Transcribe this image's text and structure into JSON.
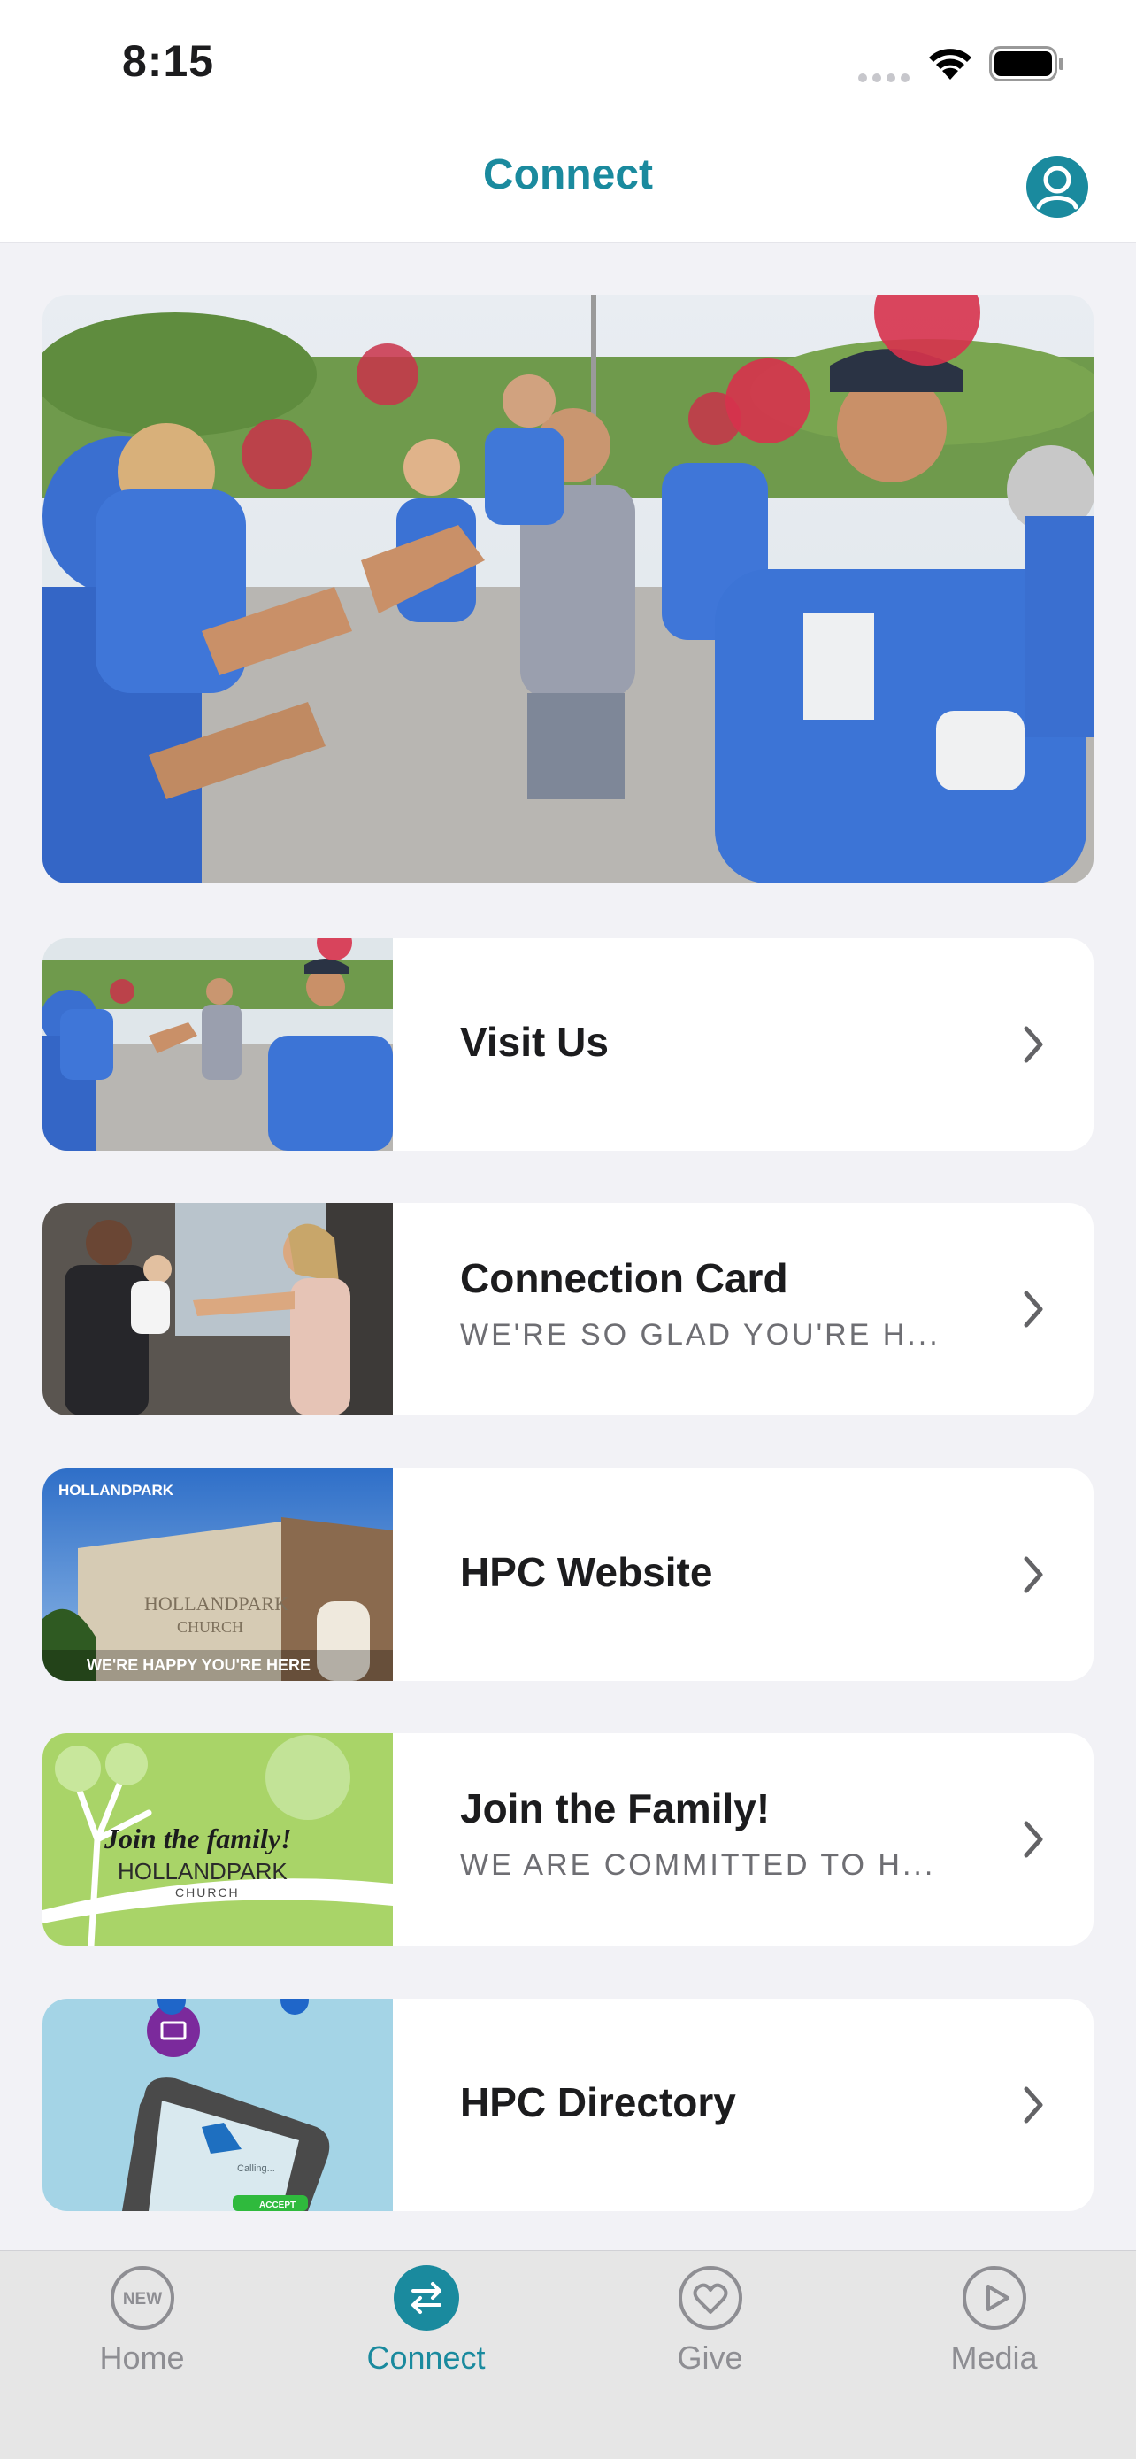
{
  "status_bar": {
    "time": "8:15"
  },
  "nav": {
    "title": "Connect"
  },
  "list": [
    {
      "title": "Visit Us",
      "subtitle": ""
    },
    {
      "title": "Connection Card",
      "subtitle": "WE'RE SO GLAD YOU'RE H..."
    },
    {
      "title": "HPC Website",
      "subtitle": ""
    },
    {
      "title": "Join the Family!",
      "subtitle": "WE ARE COMMITTED TO H..."
    },
    {
      "title": "HPC Directory",
      "subtitle": ""
    }
  ],
  "thumbnails": {
    "website_brand": "HOLLANDPARK",
    "website_building_line1": "HOLLANDPARK",
    "website_building_line2": "CHURCH",
    "website_tagline": "WE'RE HAPPY YOU'RE HERE",
    "family_script": "Join the family!",
    "family_brand": "HOLLANDPARK",
    "family_church": "CHURCH",
    "directory_screen": "Calling...",
    "directory_accept": "ACCEPT"
  },
  "tabs": [
    {
      "label": "Home",
      "badge": "NEW"
    },
    {
      "label": "Connect"
    },
    {
      "label": "Give"
    },
    {
      "label": "Media"
    }
  ],
  "colors": {
    "accent": "#1a8a9e",
    "background": "#f2f2f6",
    "tab_inactive": "#8e8e93",
    "shirt_blue": "#3a6fd0"
  }
}
